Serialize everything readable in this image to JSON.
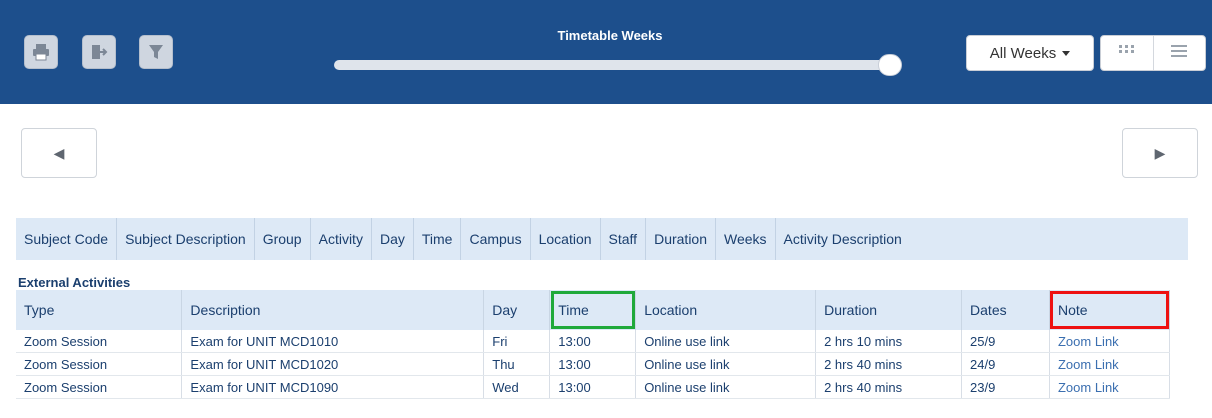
{
  "toolbar": {
    "print_icon": "printer-icon",
    "export_icon": "export-icon",
    "filter_icon": "filter-icon",
    "timeline_title": "Timetable Weeks",
    "weeks_select_value": "All Weeks",
    "grid_view_icon": "grid-view-icon",
    "list_view_icon": "list-view-icon",
    "bar_color": "#1d4f8c"
  },
  "nav": {
    "prev_glyph": "◀",
    "next_glyph": "▶"
  },
  "columns": [
    "Subject Code",
    "Subject Description",
    "Group",
    "Activity",
    "Day",
    "Time",
    "Campus",
    "Location",
    "Staff",
    "Duration",
    "Weeks",
    "Activity Description"
  ],
  "external": {
    "title": "External Activities",
    "headers": {
      "type": "Type",
      "description": "Description",
      "day": "Day",
      "time": "Time",
      "location": "Location",
      "duration": "Duration",
      "dates": "Dates",
      "note": "Note"
    },
    "rows": [
      {
        "type": "Zoom Session",
        "description": "Exam for UNIT MCD1010",
        "day": "Fri",
        "time": "13:00",
        "location": "Online use link",
        "duration": "2 hrs 10 mins",
        "dates": "25/9",
        "note": "Zoom Link"
      },
      {
        "type": "Zoom Session",
        "description": "Exam for UNIT MCD1020",
        "day": "Thu",
        "time": "13:00",
        "location": "Online use link",
        "duration": "2 hrs 40 mins",
        "dates": "24/9",
        "note": "Zoom Link"
      },
      {
        "type": "Zoom Session",
        "description": "Exam for UNIT MCD1090",
        "day": "Wed",
        "time": "13:00",
        "location": "Online use link",
        "duration": "2 hrs 40 mins",
        "dates": "23/9",
        "note": "Zoom Link"
      }
    ]
  },
  "highlight_colors": {
    "time_header": "#1fa93a",
    "note_header": "#ee1111"
  }
}
